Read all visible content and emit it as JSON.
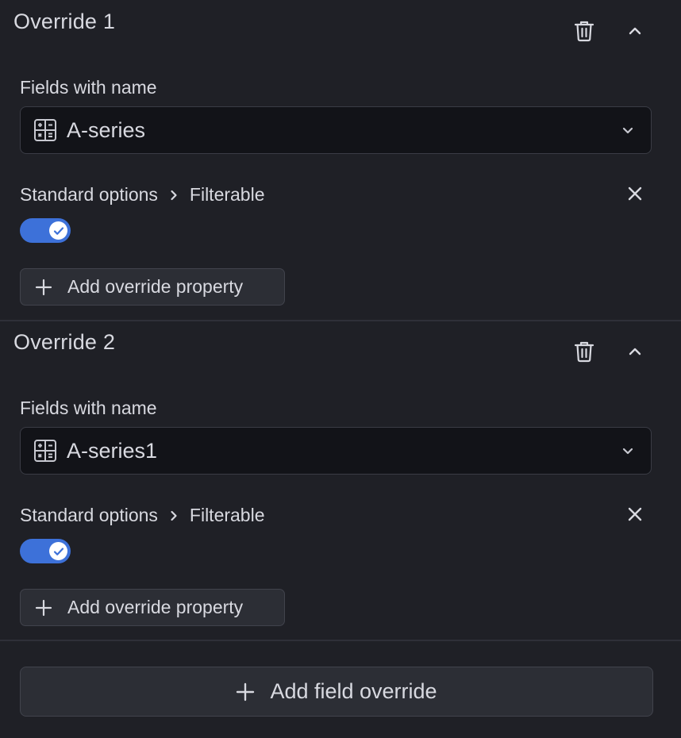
{
  "overrides": [
    {
      "title": "Override 1",
      "matcher_label": "Fields with name",
      "matcher_value": "A-series",
      "property_category": "Standard options",
      "property_name": "Filterable",
      "toggle_on": true,
      "add_property_label": "Add override property"
    },
    {
      "title": "Override 2",
      "matcher_label": "Fields with name",
      "matcher_value": "A-series1",
      "property_category": "Standard options",
      "property_name": "Filterable",
      "toggle_on": true,
      "add_property_label": "Add override property"
    }
  ],
  "add_field_override_label": "Add field override",
  "icons": {
    "delete": "trash-icon",
    "collapse": "chevron-up-icon",
    "field": "calculator-icon",
    "dropdown": "chevron-down-icon",
    "separator": "chevron-right-icon",
    "remove": "close-icon",
    "toggle": "check-icon",
    "add": "plus-icon"
  },
  "colors": {
    "background": "#1f2026",
    "text": "#d8d9e0",
    "toggle_on": "#3d71d9",
    "input_bg": "#121318",
    "button_bg": "#2c2e35"
  }
}
